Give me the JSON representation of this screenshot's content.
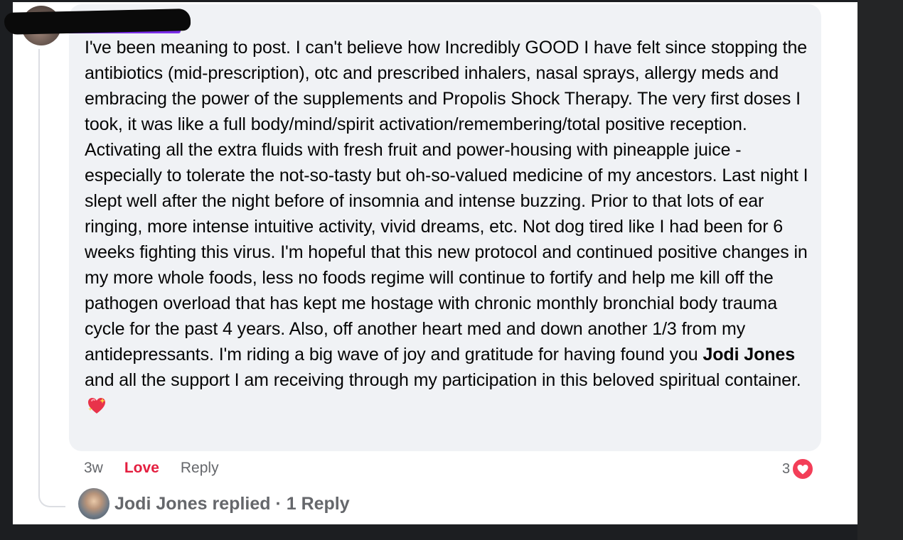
{
  "comment": {
    "author_name": "",
    "text_before_mention": "I've been meaning to post. I can't believe how Incredibly GOOD I have felt since stopping the antibiotics (mid-prescription), otc and prescribed inhalers, nasal sprays, allergy meds and embracing the power of the supplements and Propolis Shock Therapy. The very first doses I took, it was like a full body/mind/spirit activation/remembering/total positive reception. Activating all the extra fluids with fresh fruit and power-housing with pineapple juice - especially to tolerate the not-so-tasty but oh-so-valued medicine of my ancestors. Last night I slept well after the night before of insomnia and intense buzzing. Prior to that lots of ear ringing, more intense intuitive activity, vivid dreams, etc. Not dog tired like I had been for 6 weeks fighting this virus. I'm hopeful that this new protocol and continued positive changes in my more whole foods, less no foods regime will continue to fortify and help me kill off the pathogen overload that has kept me hostage with chronic monthly bronchial body trauma cycle for the past 4 years. Also, off another heart med and down another 1/3 from my antidepressants. I'm riding a big wave of joy and gratitude for having found you ",
    "mention": "Jodi Jones",
    "text_after_mention": " and all the support I am receiving through my participation in this beloved spiritual container.",
    "emoji": "sparkling-heart-icon"
  },
  "actions": {
    "time": "3w",
    "love_label": "Love",
    "reply_label": "Reply"
  },
  "reactions": {
    "count": "3",
    "icon": "love-reaction-icon"
  },
  "replies": {
    "summary": "Jodi Jones replied · 1 Reply"
  },
  "colors": {
    "love": "#e41e3f",
    "bubble": "#f0f2f5",
    "secondary_text": "#65676b",
    "redaction_purple": "#7a2ee8"
  }
}
